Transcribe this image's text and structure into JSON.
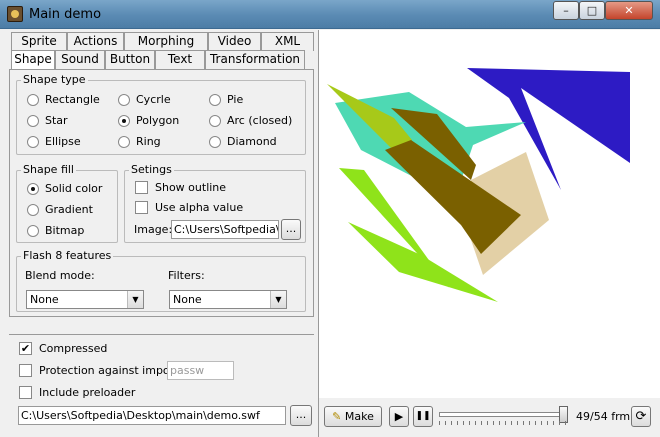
{
  "window": {
    "title": "Main demo",
    "min": "–",
    "max": "□",
    "close": "✕"
  },
  "tabs_row1": [
    "Sprite",
    "Actions",
    "Morphing",
    "Video",
    "XML"
  ],
  "tabs_row2": [
    "Shape",
    "Sound",
    "Button",
    "Text",
    "Transformation"
  ],
  "active_tab": "Shape",
  "shape_type": {
    "label": "Shape type",
    "options": [
      "Rectangle",
      "Cycrle",
      "Pie",
      "Star",
      "Polygon",
      "Arc (closed)",
      "Ellipse",
      "Ring",
      "Diamond"
    ],
    "selected": "Polygon"
  },
  "shape_fill": {
    "label": "Shape fill",
    "options": [
      "Solid color",
      "Gradient",
      "Bitmap"
    ],
    "selected": "Solid color"
  },
  "settings": {
    "label": "Setings",
    "show_outline": "Show outline",
    "use_alpha": "Use alpha value",
    "image_label": "Image:",
    "image_path": "C:\\Users\\Softpedia\\D",
    "browse": "..."
  },
  "flash8": {
    "label": "Flash 8 features",
    "blend_label": "Blend mode:",
    "blend_value": "None",
    "filters_label": "Filters:",
    "filters_value": "None"
  },
  "compressed": {
    "label": "Compressed",
    "checked": true
  },
  "protection": {
    "label": "Protection against import",
    "checked": false,
    "password": "passw"
  },
  "preloader": {
    "label": "Include preloader",
    "checked": false
  },
  "file": {
    "path": "C:\\Users\\Softpedia\\Desktop\\main\\demo.swf",
    "browse": "..."
  },
  "player": {
    "make_label": "Make",
    "play": "▶",
    "pause": "❚❚",
    "frames": "49/54 frm",
    "loop": "⟳",
    "progress": 0.907
  },
  "colors": {
    "blue": "#2d1bc4",
    "olive": "#7a6000",
    "lime": "#8fe31a",
    "yellowgreen": "#a7c919",
    "tan": "#e3d0a6",
    "teal": "#4ed9b3"
  },
  "icons": {
    "app": "flash-app-icon",
    "make": "make-wand-icon",
    "loop": "loop-icon"
  }
}
